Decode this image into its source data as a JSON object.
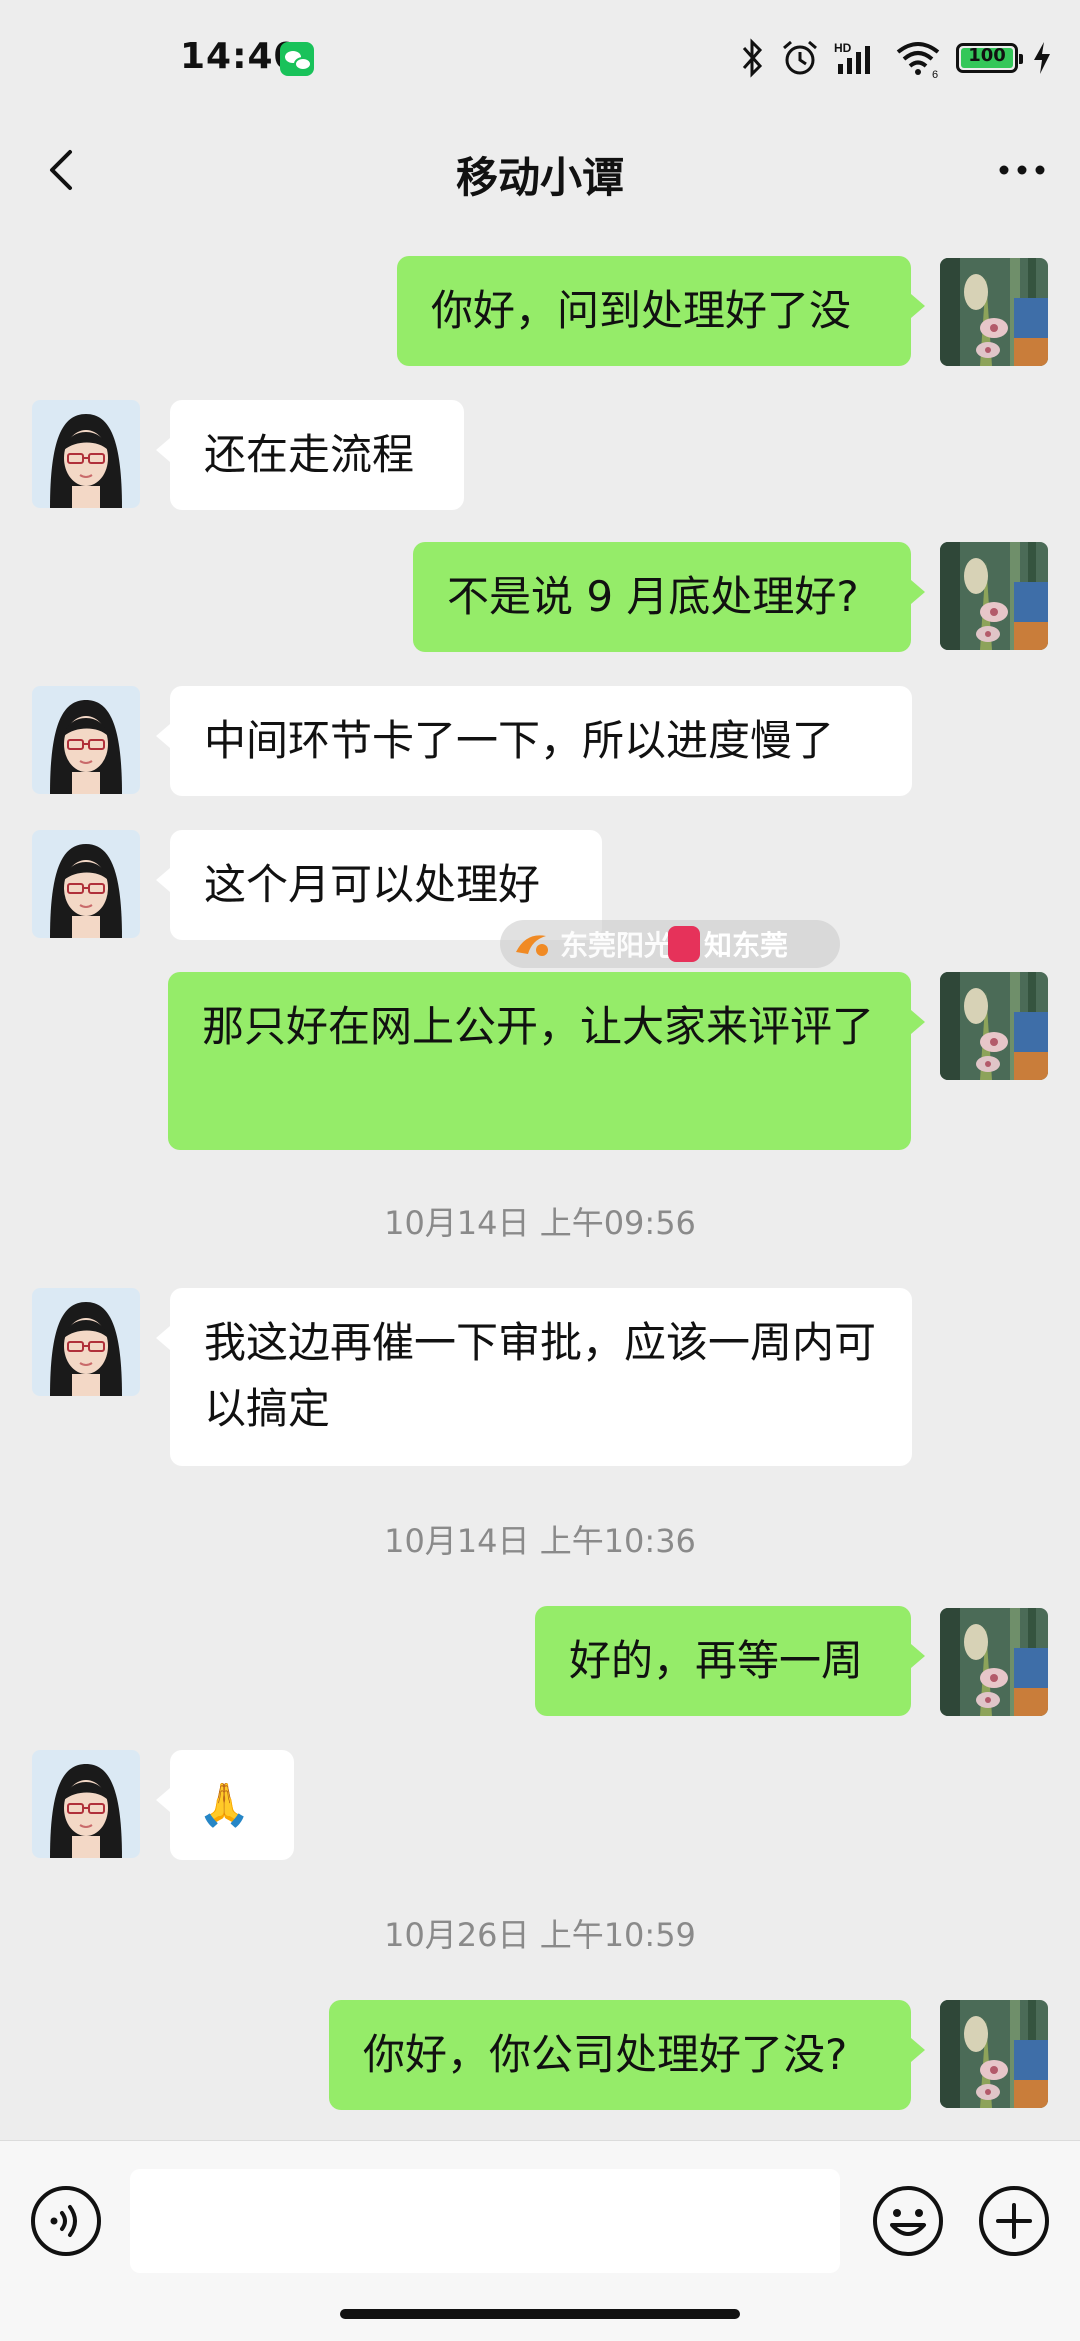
{
  "status_bar": {
    "time": "14:40",
    "battery_level": "100",
    "icons": [
      "wechat-notification-icon",
      "bluetooth-icon",
      "alarm-icon",
      "signal-icon",
      "wifi-icon",
      "battery-icon",
      "charging-icon"
    ]
  },
  "header": {
    "title": "移动小谭",
    "back_icon": "chevron-left-icon",
    "more_icon": "more-dots-icon"
  },
  "messages": [
    {
      "from": "me",
      "text": "你好，问到处理好了没"
    },
    {
      "from": "contact",
      "text": "还在走流程"
    },
    {
      "from": "me",
      "text": "不是说 9 月底处理好?"
    },
    {
      "from": "contact",
      "text": "中间环节卡了一下，所以进度慢了"
    },
    {
      "from": "contact",
      "text": "这个月可以处理好"
    },
    {
      "from": "me",
      "text": "那只好在网上公开，让大家来评评了"
    },
    {
      "timestamp": "10月14日 上午09:56"
    },
    {
      "from": "contact",
      "text": "我这边再催一下审批，应该一周内可以搞定"
    },
    {
      "timestamp": "10月14日 上午10:36"
    },
    {
      "from": "me",
      "text": "好的，再等一周"
    },
    {
      "from": "contact",
      "text": "🙏"
    },
    {
      "timestamp": "10月26日 上午10:59"
    },
    {
      "from": "me",
      "text": "你好，你公司处理好了没?"
    }
  ],
  "watermark": {
    "text1": "东莞阳光网",
    "text2": "知东莞"
  },
  "input_bar": {
    "voice_icon": "voice-icon",
    "emoji_icon": "emoji-icon",
    "plus_icon": "plus-icon",
    "input_value": ""
  },
  "colors": {
    "background": "#ededed",
    "outgoing_bubble": "#95ec69",
    "incoming_bubble": "#ffffff",
    "timestamp_text": "#8a8a8a"
  }
}
